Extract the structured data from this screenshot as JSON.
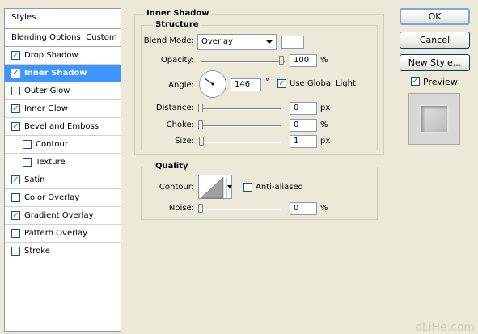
{
  "styles_panel": {
    "header": "Styles",
    "blending": "Blending Options: Custom",
    "items": [
      {
        "label": "Drop Shadow",
        "checked": true
      },
      {
        "label": "Inner Shadow",
        "checked": true,
        "selected": true
      },
      {
        "label": "Outer Glow",
        "checked": false
      },
      {
        "label": "Inner Glow",
        "checked": true
      },
      {
        "label": "Bevel and Emboss",
        "checked": true
      },
      {
        "label": "Contour",
        "checked": false,
        "indent": true
      },
      {
        "label": "Texture",
        "checked": false,
        "indent": true
      },
      {
        "label": "Satin",
        "checked": true
      },
      {
        "label": "Color Overlay",
        "checked": false
      },
      {
        "label": "Gradient Overlay",
        "checked": true
      },
      {
        "label": "Pattern Overlay",
        "checked": false
      },
      {
        "label": "Stroke",
        "checked": false
      }
    ]
  },
  "inner_shadow": {
    "title": "Inner Shadow",
    "structure_title": "Structure",
    "blend_mode_label": "Blend Mode:",
    "blend_mode_value": "Overlay",
    "opacity_label": "Opacity:",
    "opacity_value": "100",
    "opacity_unit": "%",
    "angle_label": "Angle:",
    "angle_value": "146",
    "angle_unit": "°",
    "use_global_light_label": "Use Global Light",
    "use_global_light_checked": true,
    "distance_label": "Distance:",
    "distance_value": "0",
    "distance_unit": "px",
    "choke_label": "Choke:",
    "choke_value": "0",
    "choke_unit": "%",
    "size_label": "Size:",
    "size_value": "1",
    "size_unit": "px"
  },
  "quality": {
    "title": "Quality",
    "contour_label": "Contour:",
    "anti_aliased_label": "Anti-aliased",
    "anti_aliased_checked": false,
    "noise_label": "Noise:",
    "noise_value": "0",
    "noise_unit": "%"
  },
  "buttons": {
    "ok": "OK",
    "cancel": "Cancel",
    "new_style": "New Style...",
    "preview_label": "Preview",
    "preview_checked": true
  },
  "watermark": "oLiHe.com"
}
